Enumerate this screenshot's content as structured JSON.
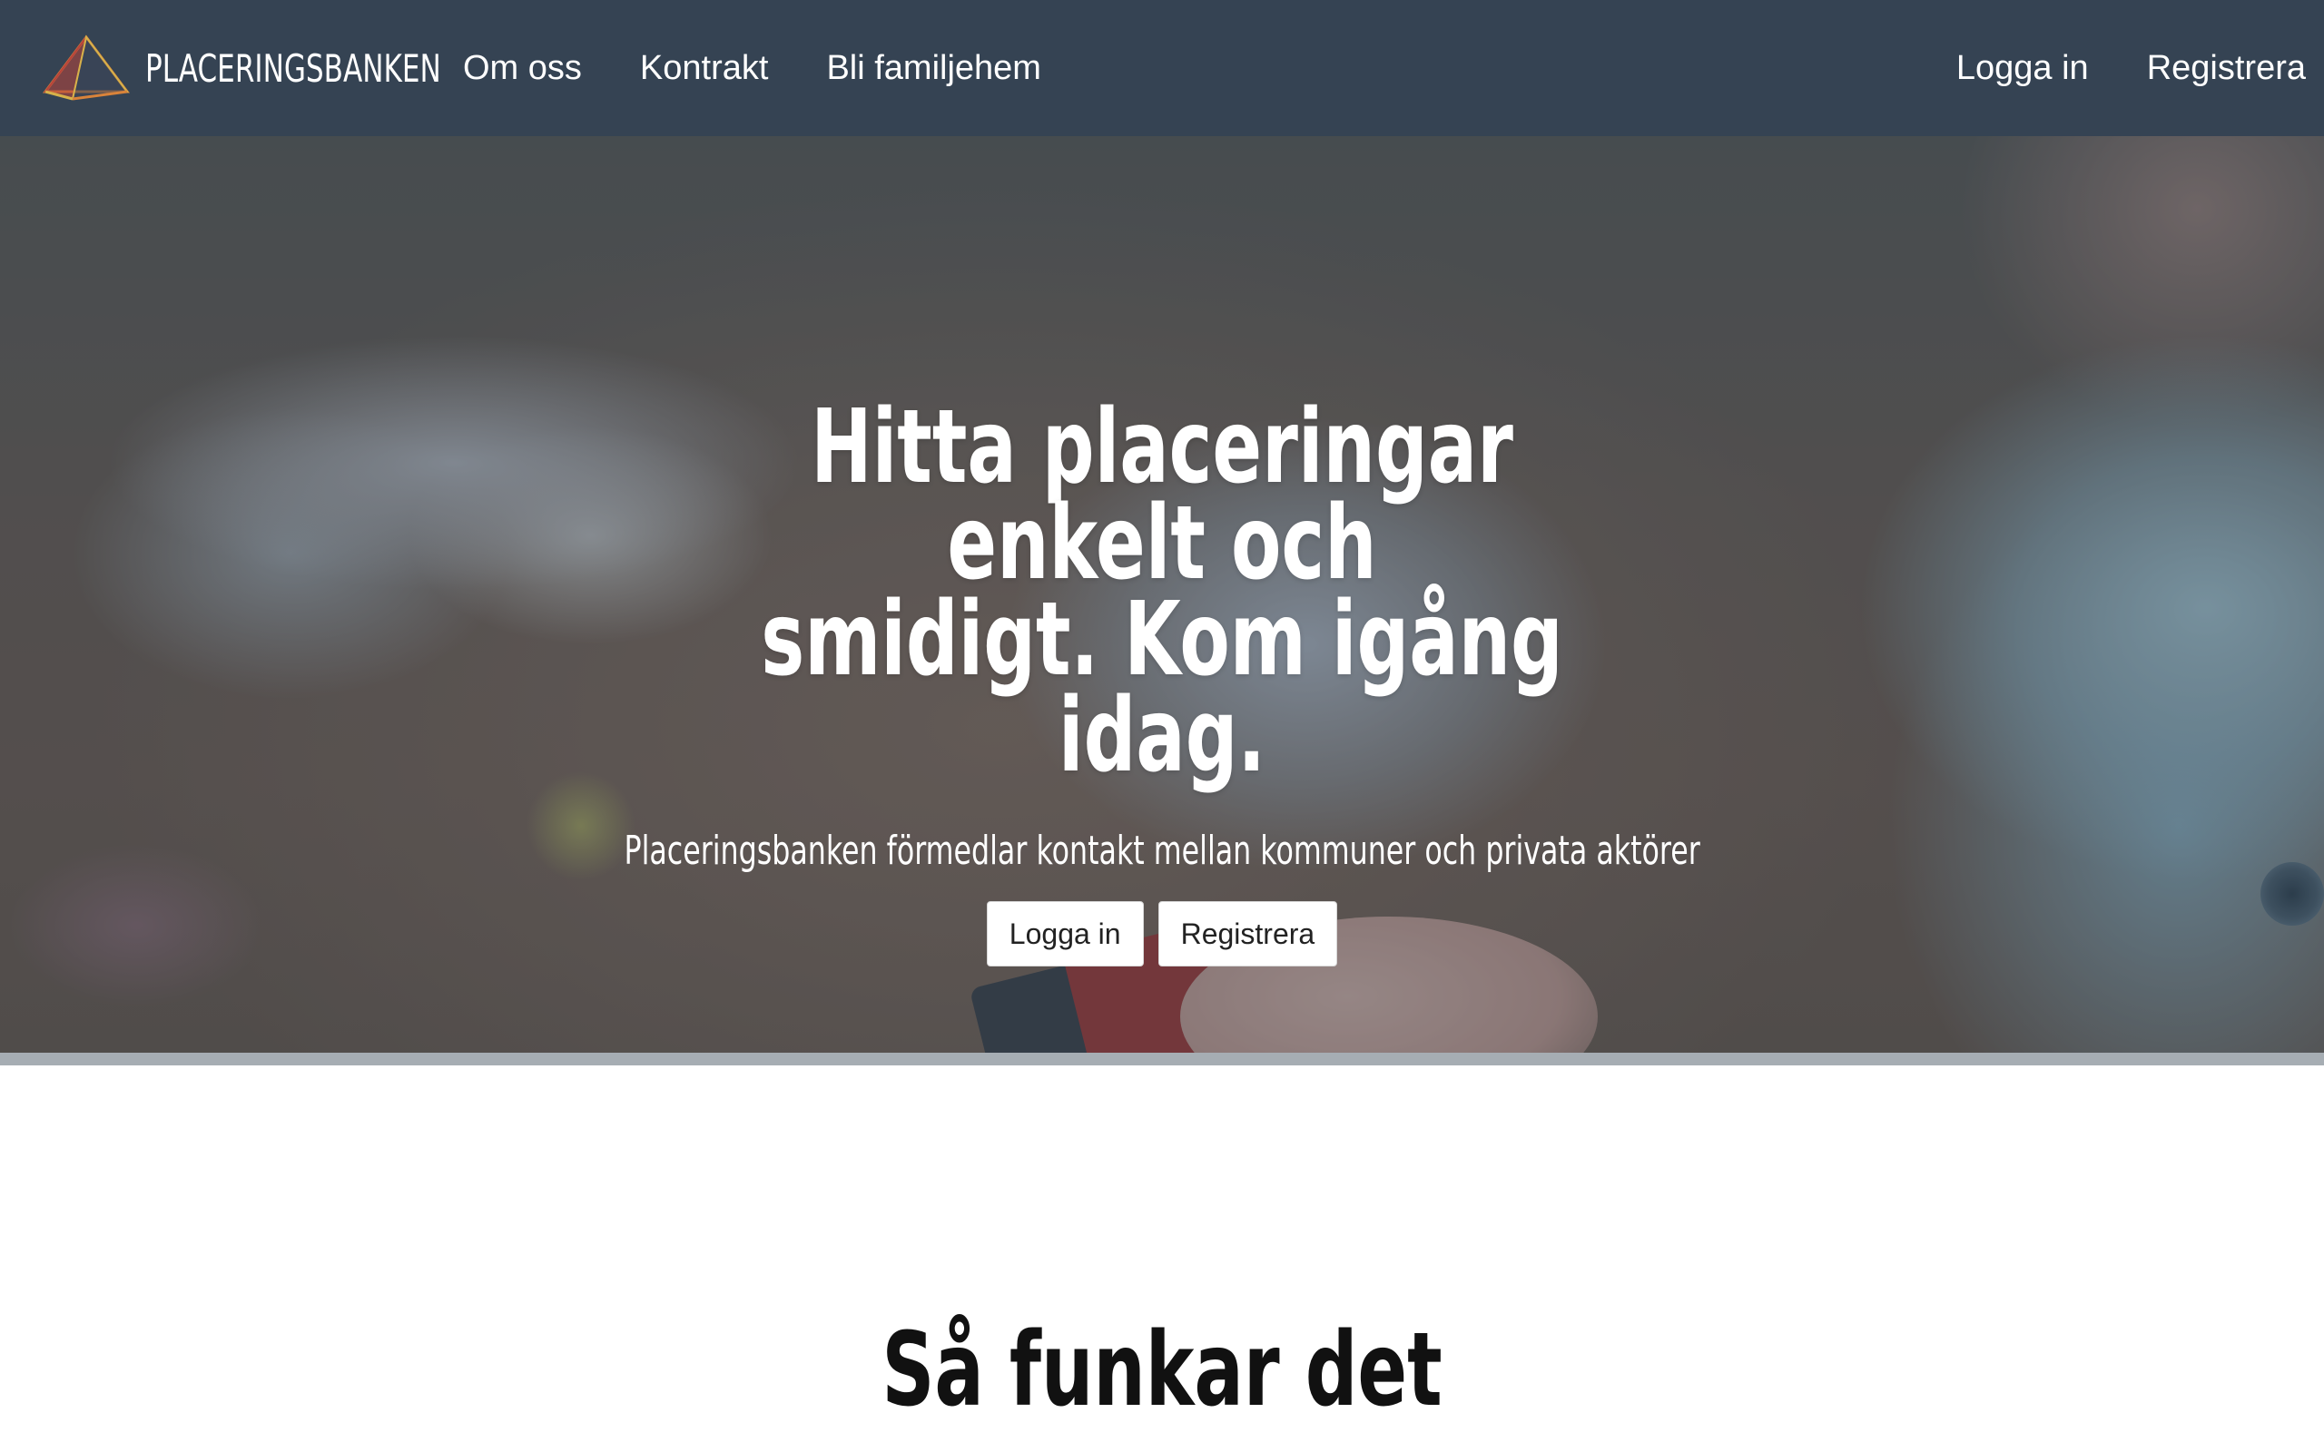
{
  "navbar": {
    "brand": "PLACERINGSBANKEN",
    "links": [
      "Om oss",
      "Kontrakt",
      "Bli familjehem"
    ],
    "right_links": [
      "Logga in",
      "Registrera"
    ]
  },
  "hero": {
    "title_line1": "Hitta placeringar enkelt och",
    "title_line2": "smidigt. Kom igång idag.",
    "subtitle": "Placeringsbanken förmedlar kontakt mellan kommuner och privata aktörer",
    "login_button": "Logga in",
    "register_button": "Registrera"
  },
  "section": {
    "title": "Så funkar det"
  },
  "colors": {
    "navbar": "#354353",
    "logo_orange": "#d9833a",
    "logo_red": "#b8433a",
    "logo_yellow": "#d7b24a"
  },
  "icons": {
    "logo": "pyramid-logo-icon"
  }
}
